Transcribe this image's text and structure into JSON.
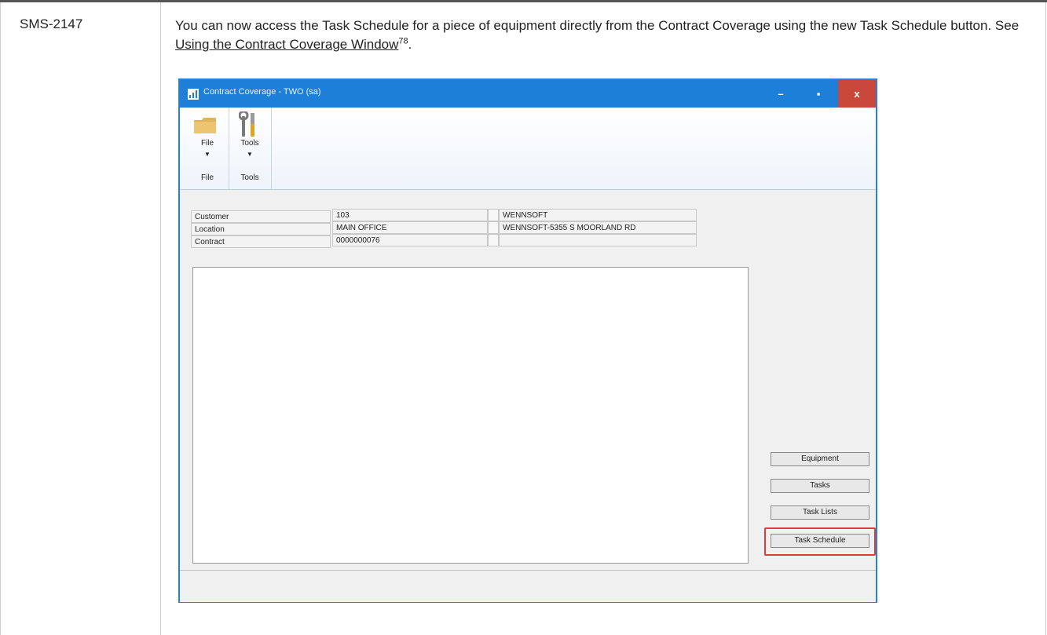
{
  "doc": {
    "issue_id": "SMS-2147",
    "description_pre": "You can now access the Task Schedule for a piece of equipment directly from the Contract Coverage using the new Task Schedule button. See ",
    "link_text": "Using the Contract Coverage Window",
    "link_sup": "78",
    "description_post": "."
  },
  "window": {
    "title": "Contract Coverage  -  TWO (sa)",
    "controls": {
      "minimize": "–",
      "maximize": "▪",
      "close": "x"
    }
  },
  "ribbon": {
    "groups": [
      {
        "button_label": "File",
        "group_label": "File",
        "icon": "folder-icon"
      },
      {
        "button_label": "Tools",
        "group_label": "Tools",
        "icon": "tools-icon"
      }
    ]
  },
  "fields": [
    {
      "label": "Customer",
      "value": "103",
      "desc": "WENNSOFT"
    },
    {
      "label": "Location",
      "value": "MAIN OFFICE",
      "desc": "WENNSOFT-5355 S MOORLAND RD"
    },
    {
      "label": "Contract",
      "value": "0000000076",
      "desc": ""
    }
  ],
  "buttons": {
    "equipment": "Equipment",
    "tasks": "Tasks",
    "task_lists": "Task Lists",
    "task_schedule": "Task Schedule"
  },
  "colors": {
    "titlebar": "#1e7fd9",
    "close": "#c9473b",
    "highlight": "#e23b3b"
  }
}
